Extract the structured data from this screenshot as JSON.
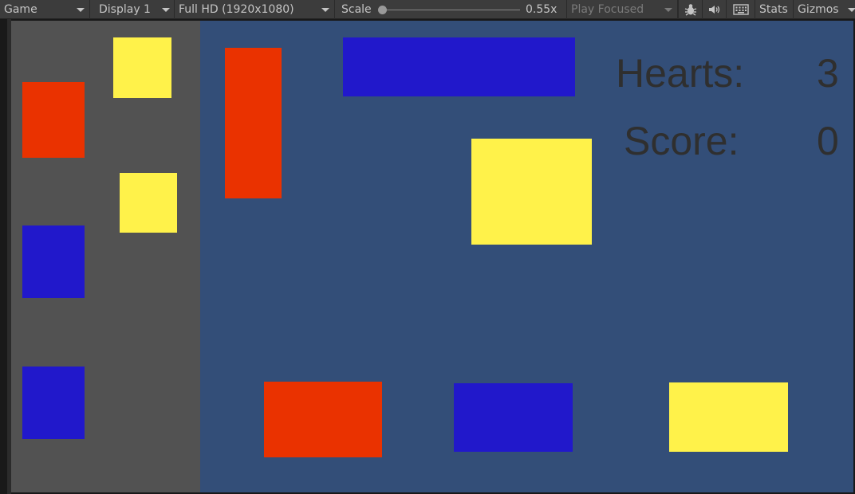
{
  "toolbar": {
    "view_mode": "Game",
    "display": "Display 1",
    "resolution": "Full HD (1920x1080)",
    "scale_label": "Scale",
    "scale_value": "0.55x",
    "scale_fraction": 0.0,
    "play_mode": "Play Focused",
    "stats_label": "Stats",
    "gizmos_label": "Gizmos",
    "icons": [
      "bug-icon",
      "audio-icon",
      "keyboard-icon"
    ]
  },
  "hud": {
    "hearts_label": "Hearts:",
    "hearts_value": "3",
    "score_label": "Score:",
    "score_value": "0"
  },
  "colors": {
    "left_panel": "#525252",
    "game_area": "#334e78",
    "red_block": "#ea3200",
    "yellow_block": "#fff24a",
    "blue_block": "#2118cb",
    "hud_text": "#2f2f2f"
  }
}
